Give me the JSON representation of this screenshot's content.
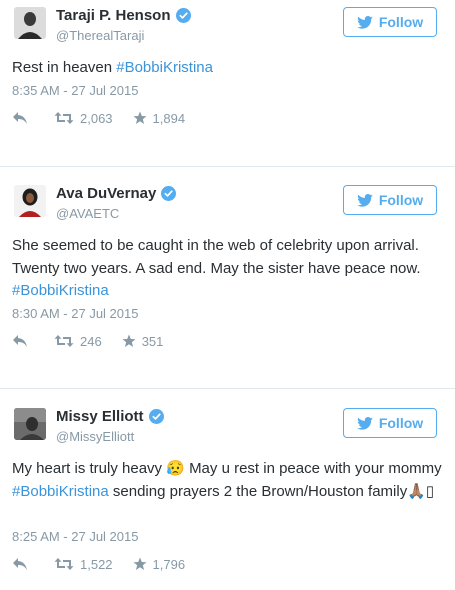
{
  "colors": {
    "accent": "#55acee",
    "hashtag": "#3b94d9",
    "meta": "#8899a6",
    "text": "#292f33"
  },
  "follow_label": "Follow",
  "tweets": [
    {
      "name": "Taraji P. Henson",
      "handle": "@TherealTaraji",
      "text_before": "Rest in heaven ",
      "hashtag": "#BobbiKristina",
      "text_after": "",
      "time": "8:35 AM - 27 Jul 2015",
      "retweets": "2,063",
      "favorites": "1,894"
    },
    {
      "name": "Ava DuVernay",
      "handle": "@AVAETC",
      "text_before": "She seemed to be caught in the web of celebrity upon arrival. Twenty two years. A sad end. May the sister have peace now. ",
      "hashtag": "#BobbiKristina",
      "text_after": "",
      "time": "8:30 AM - 27 Jul 2015",
      "retweets": "246",
      "favorites": "351"
    },
    {
      "name": "Missy Elliott",
      "handle": "@MissyElliott",
      "text_before": "My heart is truly heavy 😥 May u rest in peace with your mommy ",
      "hashtag": "#BobbiKristina",
      "text_after": " sending prayers 2 the Brown/Houston family🙏🏽▯",
      "time": "8:25 AM - 27 Jul 2015",
      "retweets": "1,522",
      "favorites": "1,796"
    }
  ]
}
